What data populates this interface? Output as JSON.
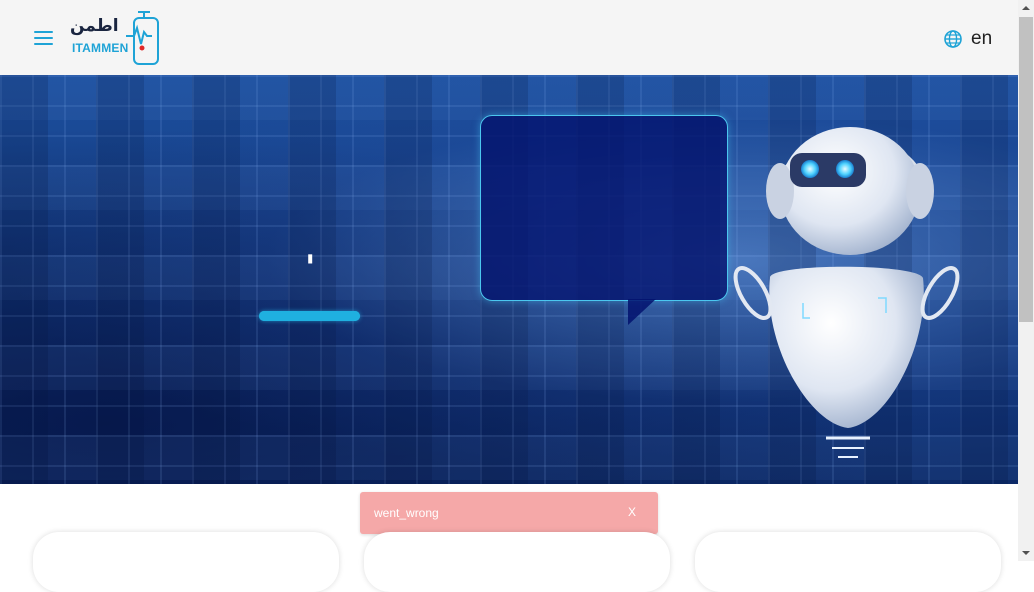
{
  "header": {
    "logo_text_ar": "اطمن",
    "logo_text_en": "ITAMMEN",
    "language_label": "en"
  },
  "hero": {
    "loader_glyph": "'",
    "progress_fraction": 1.0,
    "accent_color": "#1fb0e0"
  },
  "toast": {
    "message": "went_wrong",
    "close_label": "X",
    "background_color": "#f5a8a8"
  },
  "colors": {
    "brand": "#1ea3d6",
    "header_bg": "#f5f5f5"
  },
  "icons": {
    "menu": "hamburger-icon",
    "language": "globe-icon"
  }
}
